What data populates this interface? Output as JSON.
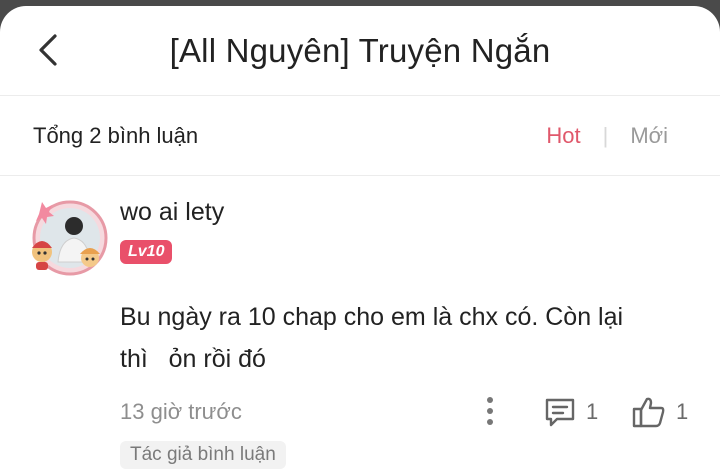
{
  "header": {
    "title": "[All Nguyên] Truyện Ngắn"
  },
  "summary": {
    "count_label": "Tổng 2 bình luận",
    "sort_hot": "Hot",
    "sort_new": "Mới"
  },
  "comment": {
    "username": "wo ai lety",
    "level": "Lv10",
    "body_line1": "Bu ngày ra 10 chap cho em là chx có. Còn lại",
    "body_line2": "thì   ỏn rồi đó",
    "time": "13 giờ trước",
    "reply_count": "1",
    "like_count": "1",
    "tag": "Tác giả bình luận"
  },
  "colors": {
    "accent": "#e0586b",
    "level_badge": "#e9506a"
  },
  "icons": {
    "back": "chevron-left-icon",
    "more": "more-vertical-icon",
    "reply": "comment-icon",
    "like": "thumbs-up-icon"
  }
}
